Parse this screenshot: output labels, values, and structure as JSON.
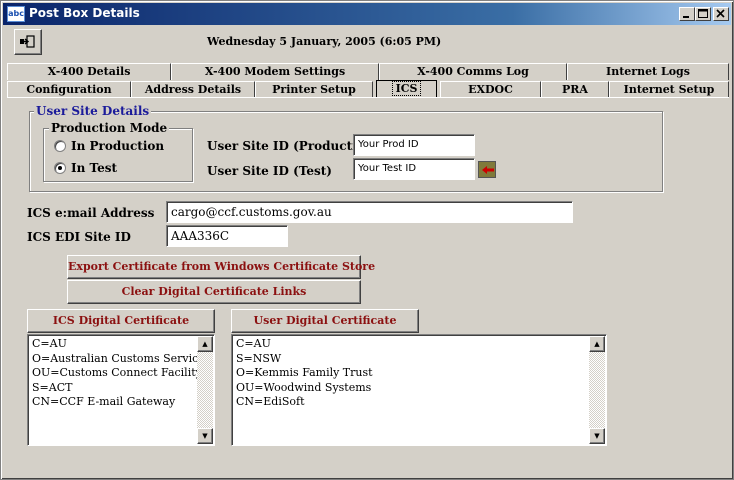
{
  "window": {
    "title": "Post Box Details",
    "icon_name": "mailbox-app-icon",
    "icon_text": "abc"
  },
  "toolbar": {
    "exit_icon": "exit-door-icon",
    "date_text": "Wednesday 5 January, 2005  (6:05 PM)"
  },
  "tabs": {
    "row1": [
      "X-400 Details",
      "X-400 Modem Settings",
      "X-400 Comms Log",
      "Internet Logs"
    ],
    "row2": [
      "Configuration",
      "Address Details",
      "Printer Setup",
      "ICS",
      "EXDOC",
      "PRA",
      "Internet Setup"
    ],
    "active": "ICS"
  },
  "user_site": {
    "group_title": "User Site Details",
    "mode_title": "Production Mode",
    "mode_options": [
      "In Production",
      "In Test"
    ],
    "selected_mode": "In Test",
    "prod_id_label": "User Site ID (Production)",
    "prod_id_value": "Your Prod ID",
    "test_id_label": "User Site ID (Test)",
    "test_id_value": "Your Test ID",
    "pointer_icon": "red-arrow-left-icon"
  },
  "ics": {
    "email_label": "ICS e:mail Address",
    "email_value": "cargo@ccf.customs.gov.au",
    "edi_label": "ICS EDI Site ID",
    "edi_value": "AAA336C"
  },
  "buttons": {
    "export_label": "Export Certificate from Windows Certificate Store",
    "clear_label": "Clear Digital Certificate Links"
  },
  "certificates": {
    "ics_title": "ICS Digital Certificate",
    "ics_lines": [
      "C=AU",
      "O=Australian Customs Service",
      "OU=Customs Connect Facility",
      "S=ACT",
      "CN=CCF E-mail Gateway"
    ],
    "user_title": "User Digital Certificate",
    "user_lines": [
      "C=AU",
      "S=NSW",
      "O=Kemmis Family Trust",
      "OU=Woodwind Systems",
      "CN=EdiSoft"
    ]
  },
  "colors": {
    "titlebar_start": "#0a246a",
    "button_text": "#8b1010",
    "window_bg": "#d4d0c8",
    "arrow": "#cc0000"
  }
}
